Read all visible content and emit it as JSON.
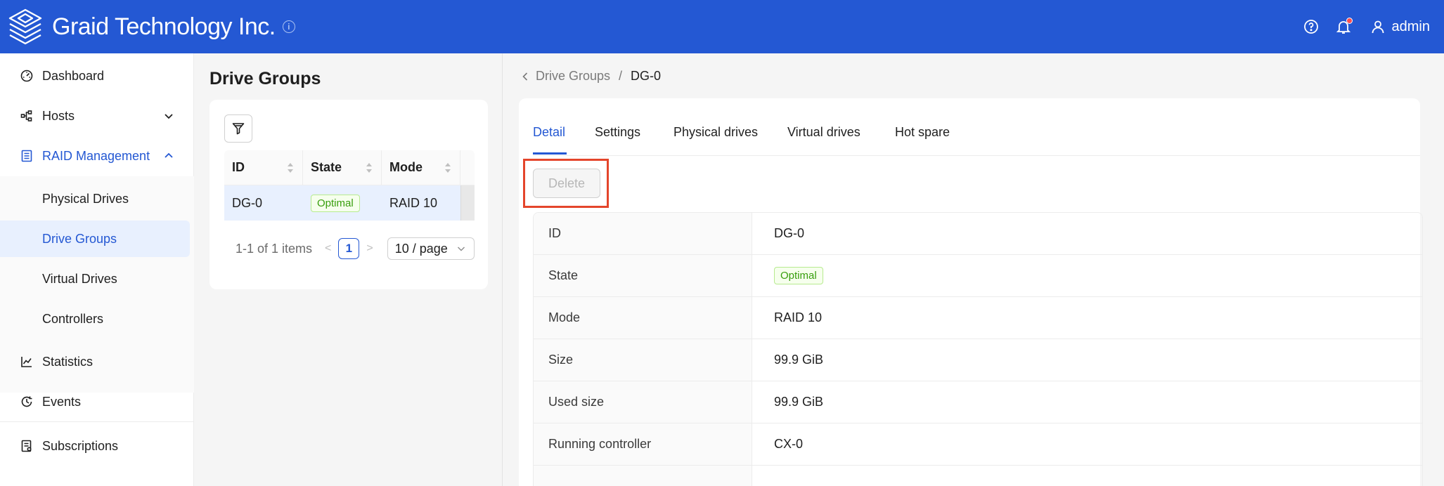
{
  "header": {
    "brand": "Graid Technology Inc.",
    "info_glyph": "i",
    "user": "admin",
    "colors": {
      "bar": "#2458d3",
      "notification_dot": "#ff4d4f"
    }
  },
  "sidebar": {
    "items": [
      {
        "label": "Dashboard",
        "icon": "dashboard-icon"
      },
      {
        "label": "Hosts",
        "icon": "hosts-icon",
        "expandable": true
      },
      {
        "label": "RAID Management",
        "icon": "raid-icon",
        "expanded": true
      },
      {
        "label": "Statistics",
        "icon": "statistics-icon"
      },
      {
        "label": "Events",
        "icon": "events-icon"
      },
      {
        "label": "Subscriptions",
        "icon": "subscriptions-icon"
      }
    ],
    "raid_submenu": [
      {
        "label": "Physical Drives"
      },
      {
        "label": "Drive Groups",
        "selected": true
      },
      {
        "label": "Virtual Drives"
      },
      {
        "label": "Controllers"
      }
    ]
  },
  "drive_groups_panel": {
    "title": "Drive Groups",
    "columns": [
      "ID",
      "State",
      "Mode"
    ],
    "rows": [
      {
        "id": "DG-0",
        "state": "Optimal",
        "mode": "RAID 10"
      }
    ],
    "pagination": {
      "summary": "1-1 of 1 items",
      "current_page": "1",
      "page_size": "10 / page",
      "prev": "<",
      "next": ">"
    }
  },
  "detail": {
    "breadcrumb": {
      "parent": "Drive Groups",
      "separator": "/",
      "current": "DG-0"
    },
    "tabs": [
      "Detail",
      "Settings",
      "Physical drives",
      "Virtual drives",
      "Hot spare"
    ],
    "active_tab": "Detail",
    "delete_label": "Delete",
    "rows": [
      {
        "key": "ID",
        "value": "DG-0"
      },
      {
        "key": "State",
        "value": "Optimal",
        "is_tag": true
      },
      {
        "key": "Mode",
        "value": "RAID 10"
      },
      {
        "key": "Size",
        "value": "99.9 GiB"
      },
      {
        "key": "Used size",
        "value": "99.9 GiB"
      },
      {
        "key": "Running controller",
        "value": "CX-0"
      }
    ]
  }
}
